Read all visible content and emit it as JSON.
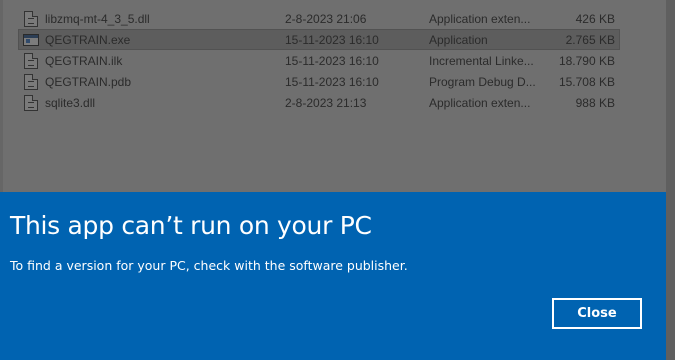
{
  "files": [
    {
      "name": "libzmq-mt-4_3_5.dll",
      "date": "2-8-2023 21:06",
      "type": "Application exten...",
      "size": "426 KB",
      "icon": "dll-file-icon",
      "selected": false
    },
    {
      "name": "QEGTRAIN.exe",
      "date": "15-11-2023 16:10",
      "type": "Application",
      "size": "2.765 KB",
      "icon": "exe-file-icon",
      "selected": true
    },
    {
      "name": "QEGTRAIN.ilk",
      "date": "15-11-2023 16:10",
      "type": "Incremental Linke...",
      "size": "18.790 KB",
      "icon": "ilk-file-icon",
      "selected": false
    },
    {
      "name": "QEGTRAIN.pdb",
      "date": "15-11-2023 16:10",
      "type": "Program Debug D...",
      "size": "15.708 KB",
      "icon": "pdb-file-icon",
      "selected": false
    },
    {
      "name": "sqlite3.dll",
      "date": "2-8-2023 21:13",
      "type": "Application exten...",
      "size": "988 KB",
      "icon": "dll-file-icon",
      "selected": false
    }
  ],
  "dialog": {
    "title": "This app can’t run on your PC",
    "message": "To find a version for your PC, check with the software publisher.",
    "close_label": "Close",
    "background_color": "#0063b1"
  }
}
